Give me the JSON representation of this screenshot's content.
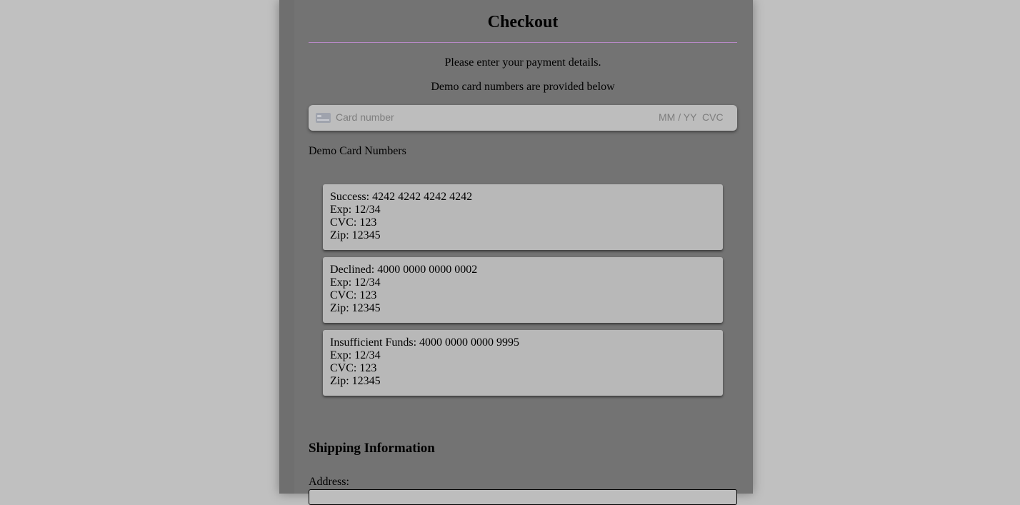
{
  "checkout": {
    "title": "Checkout",
    "instructions": "Please enter your payment details.",
    "demo_note": "Demo card numbers are provided below"
  },
  "card_input": {
    "icon": "credit-card-icon",
    "card_placeholder": "Card number",
    "expiry_placeholder": "MM / YY",
    "cvc_placeholder": "CVC"
  },
  "demo_cards": {
    "heading": "Demo Card Numbers",
    "items": [
      {
        "line1": "Success: 4242 4242 4242 4242",
        "exp": "Exp: 12/34",
        "cvc": "CVC: 123",
        "zip": "Zip: 12345"
      },
      {
        "line1": "Declined: 4000 0000 0000 0002",
        "exp": "Exp: 12/34",
        "cvc": "CVC: 123",
        "zip": "Zip: 12345"
      },
      {
        "line1": "Insufficient Funds: 4000 0000 0000 9995",
        "exp": "Exp: 12/34",
        "cvc": "CVC: 123",
        "zip": "Zip: 12345"
      }
    ]
  },
  "shipping": {
    "heading": "Shipping Information",
    "address_label": "Address:",
    "address_value": ""
  },
  "colors": {
    "page_background": "#c0c0c0",
    "panel_background": "#737373",
    "title_rule": "#b789c6",
    "card_background": "#b8b8b8"
  }
}
